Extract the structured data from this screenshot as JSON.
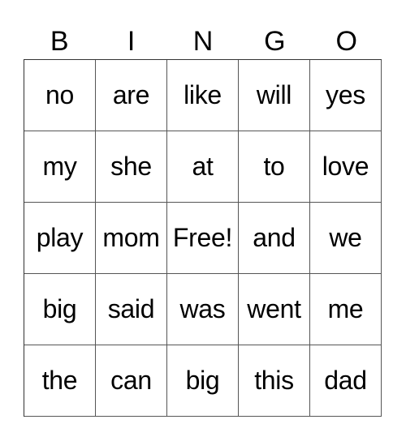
{
  "header": [
    "B",
    "I",
    "N",
    "G",
    "O"
  ],
  "rows": [
    [
      "no",
      "are",
      "like",
      "will",
      "yes"
    ],
    [
      "my",
      "she",
      "at",
      "to",
      "love"
    ],
    [
      "play",
      "mom",
      "Free!",
      "and",
      "we"
    ],
    [
      "big",
      "said",
      "was",
      "went",
      "me"
    ],
    [
      "the",
      "can",
      "big",
      "this",
      "dad"
    ]
  ]
}
